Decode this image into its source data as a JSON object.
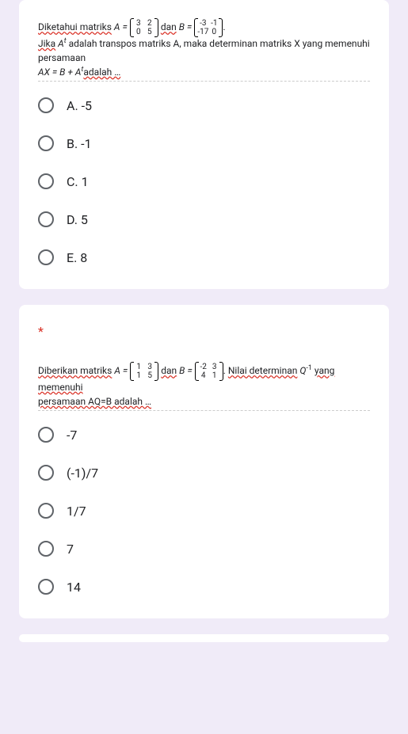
{
  "q1": {
    "prefix": "Diketahui matriks",
    "A_label": "A =",
    "A": [
      [
        "3",
        "2"
      ],
      [
        "0",
        "5"
      ]
    ],
    "dan": "dan",
    "B_label": "B =",
    "B": [
      [
        "-3",
        "-1"
      ],
      [
        "-17",
        "0"
      ]
    ],
    "line2a": "Jika",
    "At": "A",
    "t_sup": "t",
    "line2b": "adalah transpos matriks A, maka determinan matriks X yang memenuhi persamaan",
    "line3": "AX = B + A",
    "t_sup2": "t",
    "line3b": "adalah …",
    "options": {
      "a": "A. -5",
      "b": "B. -1",
      "c": "C. 1",
      "d": "D. 5",
      "e": "E. 8"
    }
  },
  "q2": {
    "required": "*",
    "prefix": "Diberikan matriks",
    "A_label": "A =",
    "A": [
      [
        "1",
        "3"
      ],
      [
        "1",
        "5"
      ]
    ],
    "dan": "dan",
    "B_label": "B =",
    "B": [
      [
        "-2",
        "3"
      ],
      [
        "4",
        "1"
      ]
    ],
    "suffix1": "Nilai determinan",
    "Q": "Q",
    "Qexp": "-1",
    "suffix2": "yang memenuhi",
    "line2": "persamaan AQ=B adalah …",
    "options": {
      "a": "-7",
      "b": "(-1)/7",
      "c": "1/7",
      "d": "7",
      "e": "14"
    }
  }
}
